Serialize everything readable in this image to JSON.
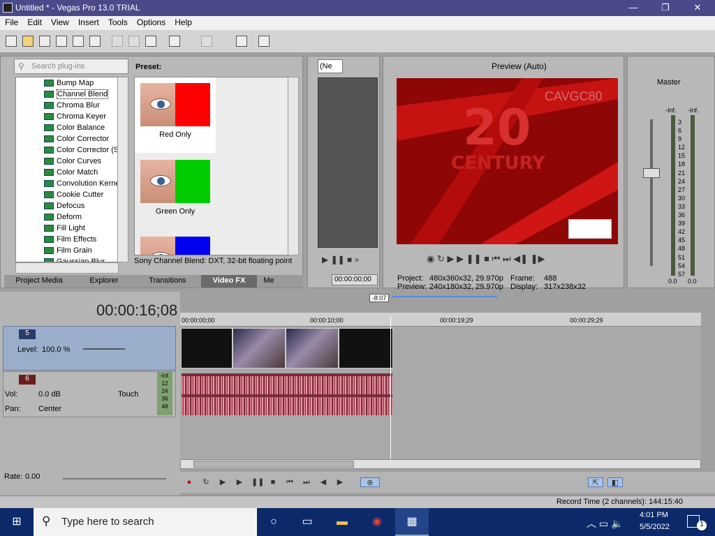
{
  "window": {
    "title": "Untitled * - Vegas Pro 13.0 TRIAL",
    "minimize": "—",
    "restore": "❐",
    "close": "✕"
  },
  "menu": [
    "File",
    "Edit",
    "View",
    "Insert",
    "Tools",
    "Options",
    "Help"
  ],
  "fx": {
    "search_placeholder": "Search plug-ins",
    "preset_label": "Preset:",
    "items": [
      "Bump Map",
      "Channel Blend",
      "Chroma Blur",
      "Chroma Keyer",
      "Color Balance",
      "Color Corrector",
      "Color Corrector (S",
      "Color Curves",
      "Color Match",
      "Convolution Kerne",
      "Cookie Cutter",
      "Defocus",
      "Deform",
      "Fill Light",
      "Film Effects",
      "Film Grain",
      "Gaussian Blur"
    ],
    "selected_index": 1,
    "presets": [
      {
        "label": "Red Only",
        "color": "#ff0000"
      },
      {
        "label": "Green Only",
        "color": "#00cc00"
      },
      {
        "label": "Blue Only",
        "color": "#0000ee"
      }
    ],
    "description": "Sony Channel Blend: DXT, 32-bit floating point"
  },
  "tabs": [
    "Project Media",
    "Explorer",
    "Transitions",
    "Video FX",
    "Me"
  ],
  "active_tab": 3,
  "trimmer": {
    "dropdown": "(Ne",
    "timecode": "00:00:00;00"
  },
  "preview": {
    "quality": "Preview (Auto)",
    "overlay_text": "CAVGC80",
    "project_label": "Project:",
    "project_value": "480x360x32, 29.970p",
    "preview_label": "Preview:",
    "preview_value": "240x180x32, 29.970p",
    "frame_label": "Frame:",
    "frame_value": "488",
    "display_label": "Display:",
    "display_value": "317x238x32"
  },
  "mixer": {
    "title": "Master",
    "left_inf": "-Inf.",
    "right_inf": "-Inf.",
    "scale": [
      "3",
      "6",
      "9",
      "12",
      "15",
      "18",
      "21",
      "24",
      "27",
      "30",
      "33",
      "36",
      "39",
      "42",
      "45",
      "48",
      "51",
      "54",
      "57"
    ],
    "left_val": "0.0",
    "right_val": "0.0"
  },
  "timeline": {
    "timecode": "00:00:16;08",
    "loop_length": "-8:07",
    "ruler": [
      "00:00:00;00",
      "00:00:10;00",
      "00:00:19;29",
      "00:00:29;29"
    ],
    "video_track": {
      "number": "5",
      "level_label": "Level:",
      "level_value": "100.0 %"
    },
    "audio_track": {
      "number": "6",
      "vol_label": "Vol:",
      "vol_value": "0.0 dB",
      "pan_label": "Pan:",
      "pan_value": "Center",
      "mode": "Touch",
      "meter_top": "-Inf.",
      "meter_scale": [
        "12",
        "24",
        "36",
        "48"
      ]
    }
  },
  "rate": {
    "label": "Rate:",
    "value": "0.00"
  },
  "status": {
    "record_time": "Record Time (2 channels): 144:15:40"
  },
  "taskbar": {
    "search": "Type here to search",
    "time": "4:01 PM",
    "date": "5/5/2022",
    "notifications": "1"
  },
  "colors": {
    "title_bg": "#4a4a8a",
    "video_red": "#a00808",
    "audio_clip": "#7a2a3a",
    "taskbar": "#0c2a6a"
  }
}
